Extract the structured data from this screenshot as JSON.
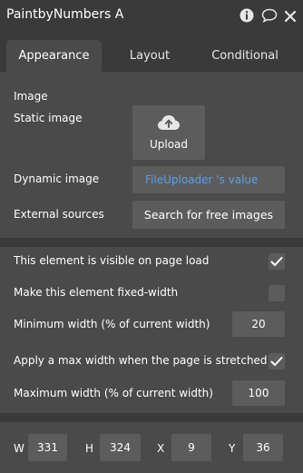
{
  "window": {
    "title": "PaintbyNumbers A",
    "icons": [
      "info-icon",
      "comment-icon",
      "close-icon"
    ]
  },
  "tabs": [
    {
      "label": "Appearance",
      "active": true
    },
    {
      "label": "Layout",
      "active": false
    },
    {
      "label": "Conditional",
      "active": false
    }
  ],
  "image_section": {
    "heading": "Image",
    "static_label": "Static image",
    "upload_label": "Upload",
    "upload_icon": "cloud-upload-icon",
    "dynamic_label": "Dynamic image",
    "dynamic_value": "FileUploader 's value",
    "external_label": "External sources",
    "search_button": "Search for free images"
  },
  "options": {
    "visible_label": "This element is visible on page load",
    "visible_checked": true,
    "fixed_width_label": "Make this element fixed-width",
    "fixed_width_checked": false,
    "min_width_label": "Minimum width (% of current width)",
    "min_width_value": "20",
    "max_width_toggle_label": "Apply a max width when the page is stretched",
    "max_width_toggle_checked": true,
    "max_width_label": "Maximum width (% of current width)",
    "max_width_value": "100"
  },
  "dimensions": {
    "w_label": "W",
    "w_value": "331",
    "h_label": "H",
    "h_value": "324",
    "x_label": "X",
    "x_value": "9",
    "y_label": "Y",
    "y_value": "36"
  },
  "colors": {
    "panel_bg": "#4a4a4a",
    "header_bg": "#3a3a3a",
    "field_bg": "#5c5c5c",
    "link_blue": "#5aa0e6"
  }
}
